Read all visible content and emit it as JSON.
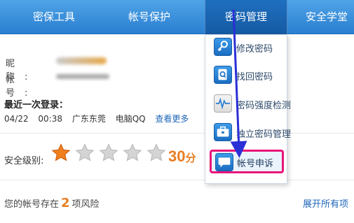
{
  "nav": {
    "items": [
      {
        "label": "密保工具"
      },
      {
        "label": "帐号保护"
      },
      {
        "label": "密码管理"
      },
      {
        "label": "安全学堂"
      }
    ]
  },
  "account": {
    "nickname_label": "昵称:",
    "account_label": "帐号:"
  },
  "last_login": {
    "title": "最近一次登录：",
    "date": "04/22",
    "time": "00:38",
    "location": "广东东莞",
    "device": "电脑QQ",
    "more_link": "查看更多"
  },
  "security": {
    "label": "安全级别:",
    "stars_filled": 1,
    "stars_total": 5,
    "score": "30",
    "score_unit": "分"
  },
  "risk": {
    "prefix": "您的帐号存在",
    "count": "2",
    "suffix": "项风险",
    "expand_link": "展开所有项"
  },
  "dropdown": {
    "items": [
      {
        "label": "修改密码",
        "icon": "key-icon"
      },
      {
        "label": "找回密码",
        "icon": "find-password-icon"
      },
      {
        "label": "密码强度检测",
        "icon": "strength-wave-icon"
      },
      {
        "label": "独立密码管理",
        "icon": "briefcase-icon"
      },
      {
        "label": "帐号申诉",
        "icon": "chat-bubble-icon"
      }
    ]
  },
  "colors": {
    "nav_blue": "#2a7fd1",
    "highlight_pink": "#e8157a",
    "score_orange": "#e67e22",
    "arrow_blue": "#2a2fd6"
  }
}
